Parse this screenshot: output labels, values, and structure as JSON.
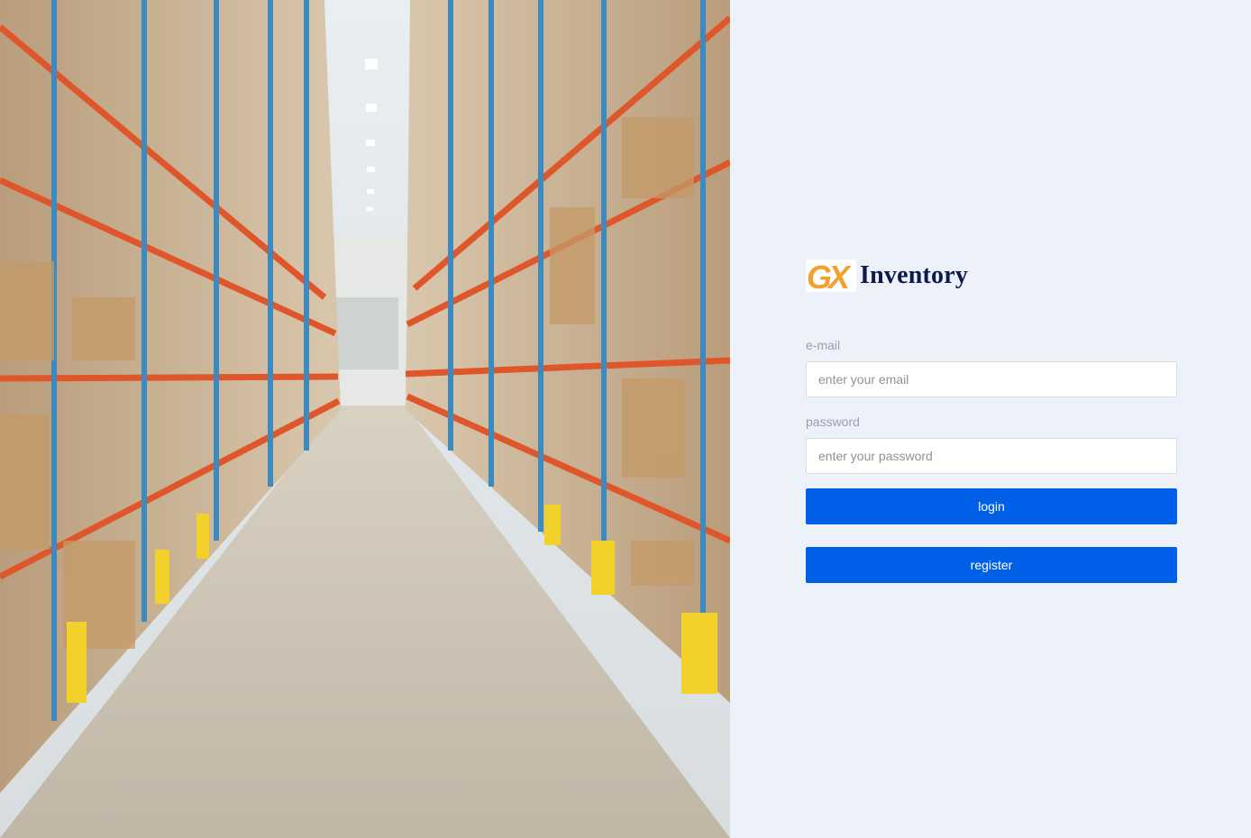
{
  "brand": {
    "logo_text": "GX",
    "name": "Inventory",
    "logo_color": "#f2a130"
  },
  "form": {
    "email_label": "e-mail",
    "email_placeholder": "enter your email",
    "email_value": "",
    "password_label": "password",
    "password_placeholder": "enter your password",
    "password_value": "",
    "login_label": "login",
    "register_label": "register"
  },
  "hero": {
    "subject": "warehouse-aisle-photo"
  },
  "colors": {
    "panel_background": "#edf1fa",
    "button_primary": "#0061e8",
    "brand_text": "#0d1a4a",
    "label_text": "#9a9fae"
  }
}
